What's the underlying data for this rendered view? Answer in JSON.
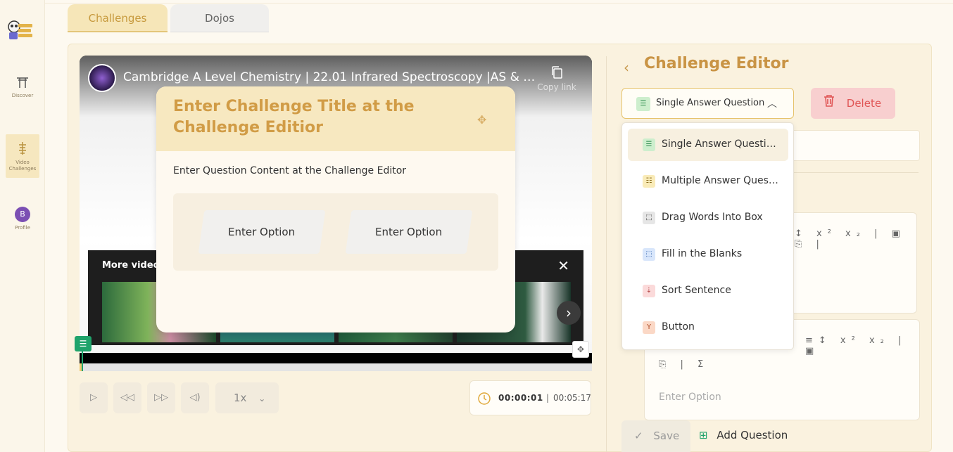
{
  "sidebar": {
    "items": [
      {
        "label": "Discover",
        "icon": "torii-gate-icon"
      },
      {
        "label": "Video Challenges",
        "icon": "tower-icon",
        "active": true
      },
      {
        "label": "Profile",
        "icon": "avatar"
      }
    ],
    "avatar_initial": "B"
  },
  "tabs": [
    {
      "label": "Challenges",
      "active": true
    },
    {
      "label": "Dojos",
      "active": false
    }
  ],
  "video": {
    "title": "Cambridge A Level Chemistry | 22.01 Infrared Spectroscopy |AS & A Le...",
    "copy_link": "Copy link",
    "more_videos": "More videos",
    "progress_fraction": 0.003
  },
  "card": {
    "title": "Enter Challenge Title at the Challenge Editior",
    "question": "Enter Question Content at the Challenge Editor",
    "options": [
      "Enter Option",
      "Enter Option"
    ]
  },
  "controls": {
    "speed": "1x",
    "current_time": "00:00:01",
    "separator": "|",
    "duration": "00:05:17"
  },
  "editor": {
    "title": "Challenge Editor",
    "selected_type": "Single Answer Question",
    "delete_label": "Delete",
    "option_placeholder": "Enter Option",
    "save_label": "Save",
    "add_question_label": "Add Question"
  },
  "dropdown": {
    "items": [
      {
        "label": "Single Answer Question",
        "icon": "single-answer-icon",
        "color": "#cdeecd",
        "active": true
      },
      {
        "label": "Multiple Answer Question",
        "icon": "multiple-answer-icon",
        "color": "#f9ebb8"
      },
      {
        "label": "Drag Words Into Box",
        "icon": "drag-words-icon",
        "color": "#e6e6e6"
      },
      {
        "label": "Fill in the Blanks",
        "icon": "fill-blanks-icon",
        "color": "#d8e6fb"
      },
      {
        "label": "Sort Sentence",
        "icon": "sort-sentence-icon",
        "color": "#fbdada"
      },
      {
        "label": "Button",
        "icon": "button-branch-icon",
        "color": "#fbd8c6"
      }
    ]
  },
  "colors": {
    "accent": "#c99445",
    "success": "#1fa36b",
    "danger": "#e05656"
  }
}
